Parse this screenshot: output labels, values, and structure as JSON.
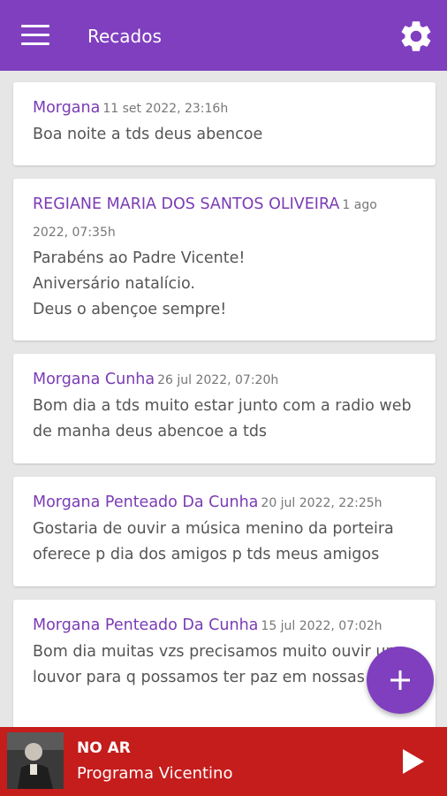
{
  "appbar": {
    "title": "Recados"
  },
  "messages": [
    {
      "author": "Morgana",
      "date": "11 set 2022, 23:16h",
      "text": "Boa noite a tds deus abencoe"
    },
    {
      "author": "REGIANE MARIA DOS SANTOS OLIVEIRA",
      "date": "1 ago 2022, 07:35h",
      "text": "Parabéns ao Padre Vicente!\nAniversário natalício.\nDeus o abençoe sempre!"
    },
    {
      "author": "Morgana Cunha",
      "date": "26 jul 2022, 07:20h",
      "text": "Bom dia a tds muito estar junto com a radio web de manha deus abencoe a tds"
    },
    {
      "author": "Morgana Penteado Da Cunha",
      "date": "20 jul 2022, 22:25h",
      "text": "Gostaria de ouvir a música menino da porteira oferece p dia dos amigos p tds meus amigos"
    },
    {
      "author": "Morgana Penteado Da Cunha",
      "date": "15 jul 2022, 07:02h",
      "text": "Bom dia muitas vzs precisamos muito ouvir um louvor para q possamos ter paz em nossas vidas"
    }
  ],
  "player": {
    "status": "NO AR",
    "program": "Programa Vicentino"
  },
  "colors": {
    "primary": "#7f3fbf",
    "author": "#7a3bb4",
    "player": "#c51c1c"
  },
  "icons": {
    "menu": "menu-icon",
    "settings": "gear-icon",
    "add": "plus-icon",
    "play": "play-icon"
  }
}
